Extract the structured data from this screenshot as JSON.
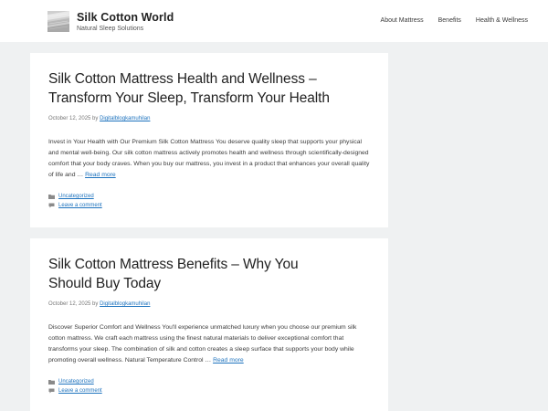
{
  "header": {
    "site_title": "Silk Cotton World",
    "site_tagline": "Natural Sleep Solutions",
    "nav": [
      {
        "label": "About Mattress"
      },
      {
        "label": "Benefits"
      },
      {
        "label": "Health & Wellness"
      }
    ]
  },
  "posts": [
    {
      "title_line1": "Silk Cotton Mattress Health and Wellness –",
      "title_line2": "Transform Your Sleep, Transform Your Health",
      "date": "October 12, 2025",
      "by": "by",
      "author": "Digitalblogkamuhilan",
      "excerpt": "Invest in Your Health with Our Premium Silk Cotton Mattress You deserve quality sleep that supports your physical and mental well-being. Our silk cotton mattress actively promotes health and wellness through scientifically-designed comfort that your body craves. When you buy our mattress, you invest in a product that enhances your overall quality of life and …",
      "read_more": "Read more",
      "category": "Uncategorized",
      "comment": "Leave a comment"
    },
    {
      "title_line1": "Silk Cotton Mattress Benefits – Why You",
      "title_line2": "Should Buy Today",
      "date": "October 12, 2025",
      "by": "by",
      "author": "Digitalblogkamuhilan",
      "excerpt": "Discover Superior Comfort and Wellness You'll experience unmatched luxury when you choose our premium silk cotton mattress. We craft each mattress using the finest natural materials to deliver exceptional comfort that transforms your sleep. The combination of silk and cotton creates a sleep surface that supports your body while promoting overall wellness. Natural Temperature Control …",
      "read_more": "Read more",
      "category": "Uncategorized",
      "comment": "Leave a comment"
    }
  ],
  "colors": {
    "link": "#1e73be",
    "background": "#eff1f2"
  },
  "icons": {
    "category": "folder-icon",
    "comment": "comment-icon"
  }
}
